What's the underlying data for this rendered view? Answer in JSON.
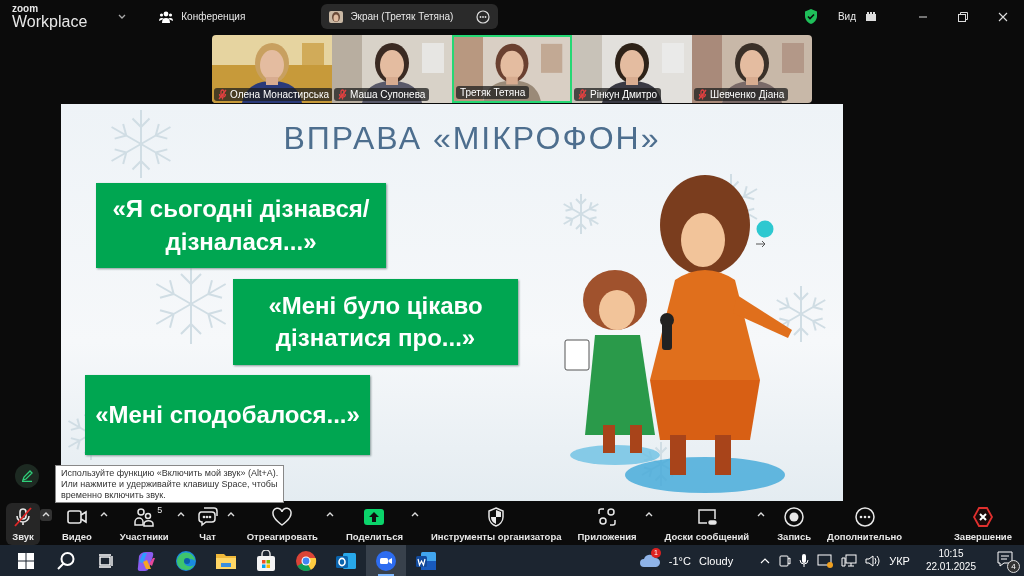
{
  "titlebar": {
    "logo_top": "zoom",
    "logo_bottom": "Workplace",
    "meeting": "Конференция",
    "share": "Экран (Третяк Тетяна)",
    "view": "Вид"
  },
  "participants": [
    {
      "name": "Олена Монастирська",
      "muted": true,
      "selected": false
    },
    {
      "name": "Маша Супонева",
      "muted": true,
      "selected": false
    },
    {
      "name": "Третяк Тетяна",
      "muted": false,
      "selected": true
    },
    {
      "name": "Рінкун Дмитро",
      "muted": true,
      "selected": false
    },
    {
      "name": "Шевченко Діана",
      "muted": true,
      "selected": false
    }
  ],
  "slide": {
    "title": "ВПРАВА «МІКРОФОН»",
    "prompts": [
      "«Я сьогодні дізнався/\nдізналася...»",
      "«Мені було цікаво\nдізнатися про...»",
      "«Мені сподобалося...»"
    ]
  },
  "tooltip": "Используйте функцию «Включить мой звук» (Alt+A).\nИли нажмите и удерживайте клавишу Space, чтобы\nвременно включить звук.",
  "toolbar": [
    {
      "kind": "audio",
      "label": "Звук",
      "selected": true,
      "muted": true,
      "caret": true
    },
    {
      "kind": "video",
      "label": "Видео",
      "selected": false,
      "caret": true
    },
    {
      "kind": "participants",
      "label": "Участники",
      "count": "5",
      "selected": false,
      "caret": true
    },
    {
      "kind": "chat",
      "label": "Чат",
      "selected": false,
      "caret": true
    },
    {
      "kind": "react",
      "label": "Отреагировать",
      "selected": false,
      "caret": true
    },
    {
      "kind": "share",
      "label": "Поделиться",
      "selected": false,
      "caret": true
    },
    {
      "kind": "host",
      "label": "Инструменты организатора",
      "selected": false,
      "caret": false
    },
    {
      "kind": "apps",
      "label": "Приложения",
      "selected": false,
      "caret": true
    },
    {
      "kind": "whiteboard",
      "label": "Доски сообщений",
      "selected": false,
      "caret": true
    },
    {
      "kind": "record",
      "label": "Запись",
      "selected": false,
      "caret": false
    },
    {
      "kind": "more",
      "label": "Дополнительно",
      "selected": false,
      "caret": false
    },
    {
      "kind": "end",
      "label": "Завершение",
      "selected": false,
      "caret": false
    }
  ],
  "taskbar": {
    "apps": [
      {
        "kind": "start",
        "selected": false
      },
      {
        "kind": "search",
        "selected": false
      },
      {
        "kind": "taskview",
        "selected": false
      },
      {
        "kind": "copilot",
        "selected": false
      },
      {
        "kind": "edge",
        "selected": false
      },
      {
        "kind": "explorer",
        "selected": false
      },
      {
        "kind": "store",
        "selected": false
      },
      {
        "kind": "chrome",
        "selected": false
      },
      {
        "kind": "outlook",
        "selected": false
      },
      {
        "kind": "zoom",
        "selected": true
      },
      {
        "kind": "word",
        "selected": false
      }
    ],
    "weather": {
      "badge": "1",
      "temp": "-1°C",
      "condition": "Cloudy"
    },
    "language": "УКР",
    "time": "10:15",
    "date": "22.01.2025",
    "notifications": "4"
  }
}
